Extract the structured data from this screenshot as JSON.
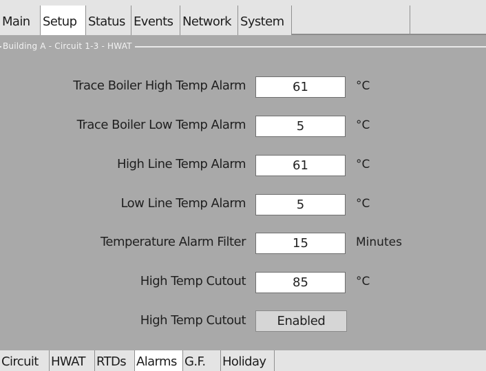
{
  "top_tabs": [
    {
      "label": "Main",
      "active": false
    },
    {
      "label": "Setup",
      "active": true
    },
    {
      "label": "Status",
      "active": false
    },
    {
      "label": "Events",
      "active": false
    },
    {
      "label": "Network",
      "active": false
    },
    {
      "label": "System",
      "active": false
    }
  ],
  "group": {
    "caption": "Building A - Circuit 1-3 - HWAT"
  },
  "settings": [
    {
      "label": "Trace Boiler High Temp Alarm",
      "value": "61",
      "unit": "°C"
    },
    {
      "label": "Trace Boiler Low Temp Alarm",
      "value": "5",
      "unit": "°C"
    },
    {
      "label": "High Line Temp Alarm",
      "value": "61",
      "unit": "°C"
    },
    {
      "label": "Low Line Temp Alarm",
      "value": "5",
      "unit": "°C"
    },
    {
      "label": "Temperature Alarm Filter",
      "value": "15",
      "unit": "Minutes"
    },
    {
      "label": "High Temp Cutout",
      "value": "85",
      "unit": "°C"
    }
  ],
  "cutout_toggle": {
    "label": "High Temp Cutout",
    "value": "Enabled"
  },
  "bottom_tabs": [
    {
      "label": "Circuit",
      "active": false
    },
    {
      "label": "HWAT",
      "active": false
    },
    {
      "label": "RTDs",
      "active": false
    },
    {
      "label": "Alarms",
      "active": true
    },
    {
      "label": "G.F.",
      "active": false
    },
    {
      "label": "Holiday",
      "active": false
    }
  ]
}
